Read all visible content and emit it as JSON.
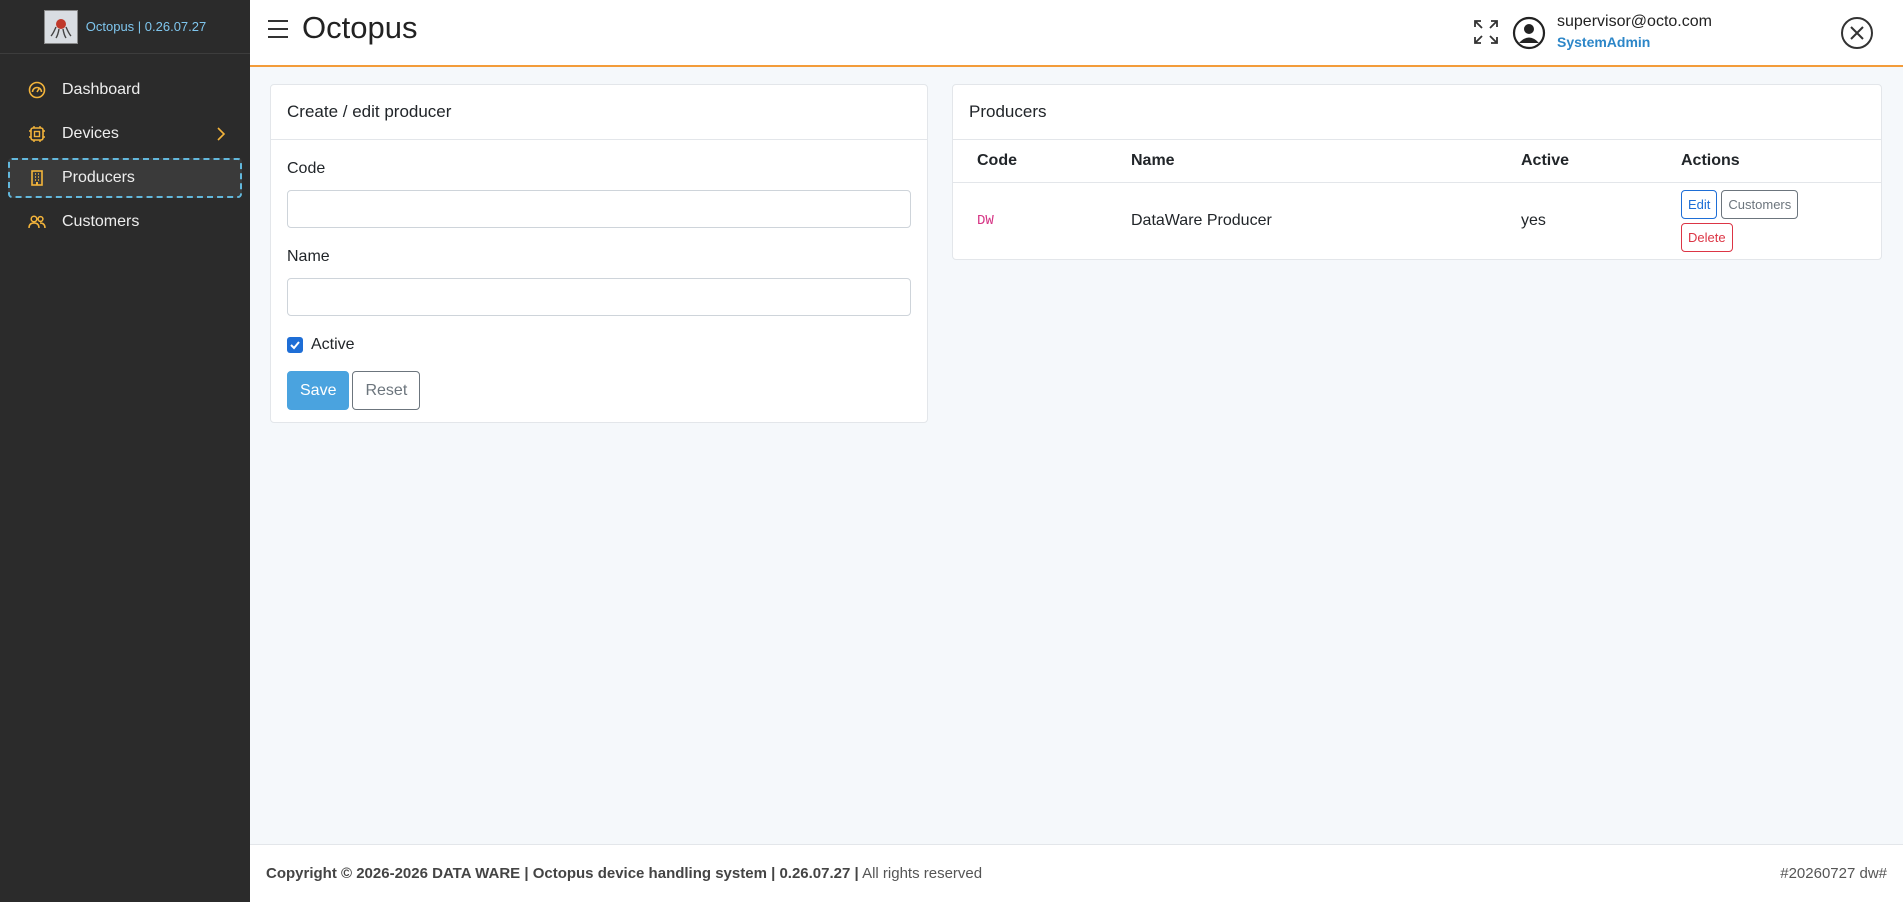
{
  "brand": {
    "text": "Octopus | 0.26.07.27",
    "logo_icon": "octopus-logo"
  },
  "sidebar": {
    "items": [
      {
        "label": "Dashboard",
        "icon": "dashboard-gauge-icon"
      },
      {
        "label": "Devices",
        "icon": "cpu-chip-icon",
        "has_submenu": true
      },
      {
        "label": "Producers",
        "icon": "building-icon",
        "active": true
      },
      {
        "label": "Customers",
        "icon": "people-icon"
      }
    ]
  },
  "header": {
    "title": "Octopus",
    "user_email": "supervisor@octo.com",
    "user_role": "SystemAdmin"
  },
  "form": {
    "title": "Create / edit producer",
    "code_label": "Code",
    "code_value": "",
    "name_label": "Name",
    "name_value": "",
    "active_label": "Active",
    "active_checked": true,
    "save_label": "Save",
    "reset_label": "Reset"
  },
  "producers": {
    "title": "Producers",
    "columns": [
      "Code",
      "Name",
      "Active",
      "Actions"
    ],
    "rows": [
      {
        "code": "DW",
        "name": "DataWare Producer",
        "active": "yes",
        "actions": {
          "edit": "Edit",
          "customers": "Customers",
          "delete": "Delete"
        }
      }
    ]
  },
  "footer": {
    "copyright": "Copyright © 2026-2026 DATA WARE | Octopus device handling system | 0.26.07.27 |",
    "rights": "All rights reserved",
    "build": "#20260727 dw#"
  },
  "colors": {
    "sidebar_bg": "#2b2b2b",
    "accent_orange": "#f39c3a",
    "icon_yellow": "#f3b43b",
    "primary_blue": "#1e6ed6",
    "save_blue": "#4aa3df",
    "danger_red": "#dc3545"
  }
}
